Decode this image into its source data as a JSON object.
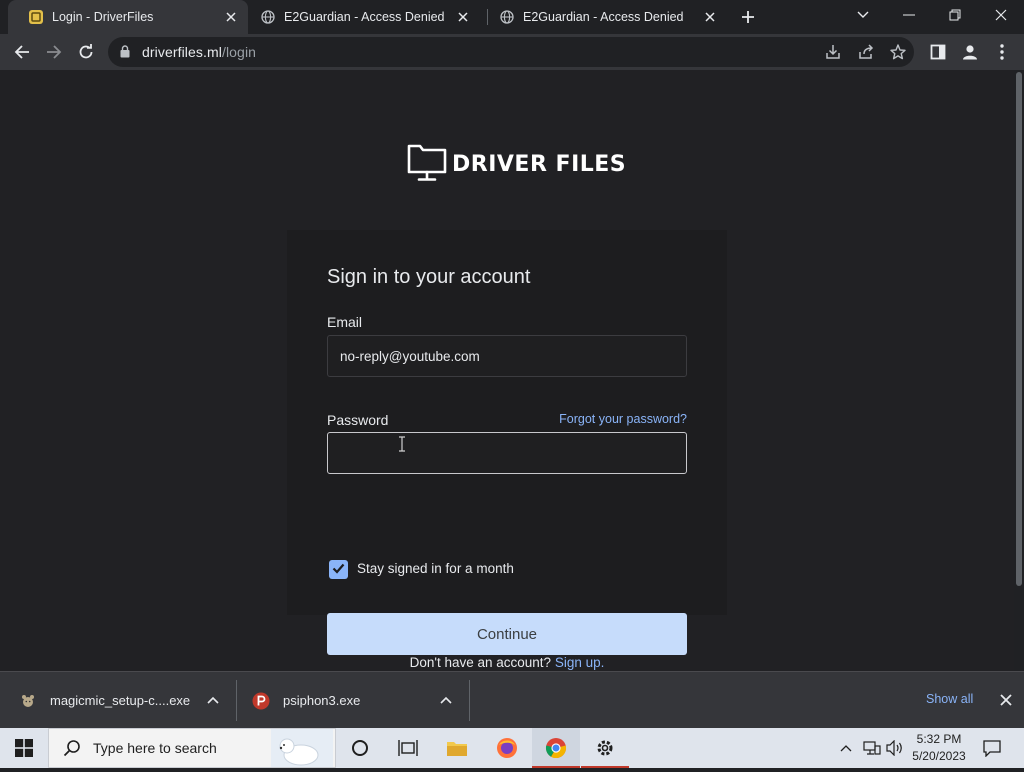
{
  "tabs": [
    {
      "title": "Login - DriverFiles",
      "active": true
    },
    {
      "title": "E2Guardian - Access Denied",
      "active": false
    },
    {
      "title": "E2Guardian - Access Denied",
      "active": false
    }
  ],
  "address": {
    "host": "driverfiles.ml",
    "path": "/login"
  },
  "page": {
    "logo_text": "DRIVER FILES",
    "heading": "Sign in to your account",
    "email_label": "Email",
    "email_value": "no-reply@youtube.com",
    "password_label": "Password",
    "password_value": "",
    "forgot_link": "Forgot your password?",
    "stay_signed_in": "Stay signed in for a month",
    "stay_signed_in_checked": true,
    "continue_button": "Continue",
    "no_account_text": "Don't have an account?",
    "signup_link": "Sign up."
  },
  "downloads": {
    "items": [
      {
        "name": "magicmic_setup-c....exe",
        "icon": "bear-icon"
      },
      {
        "name": "psiphon3.exe",
        "icon": "psiphon-icon"
      }
    ],
    "show_all": "Show all"
  },
  "taskbar": {
    "search_placeholder": "Type here to search",
    "time": "5:32 PM",
    "date": "5/20/2023"
  },
  "colors": {
    "accent_link": "#8ab4f8",
    "continue_bg": "#c6dcfb",
    "checkbox": "#8ab4f8"
  }
}
